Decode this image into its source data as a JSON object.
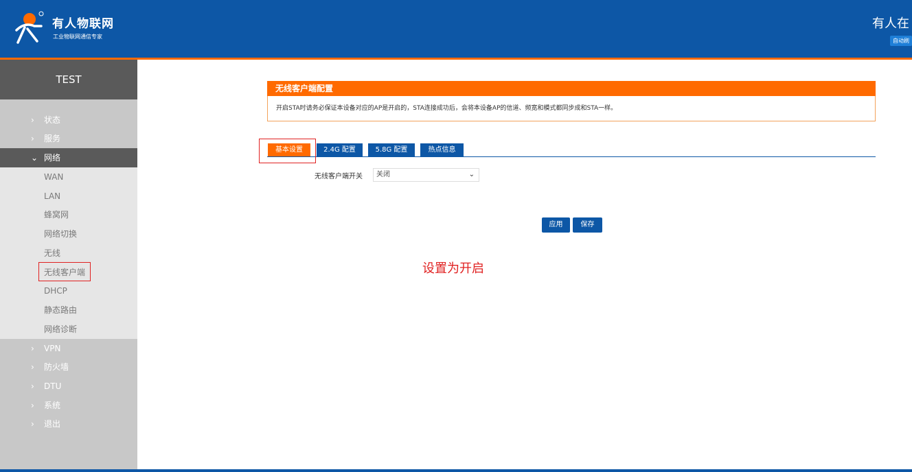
{
  "header": {
    "brand_name": "有人物联网",
    "brand_slogan": "工业物联网通信专家",
    "right_title": "有人在",
    "auto_badge": "自动刷"
  },
  "sidebar": {
    "device_name": "TEST",
    "menu": [
      {
        "label": "状态"
      },
      {
        "label": "服务"
      },
      {
        "label": "网络"
      },
      {
        "label": "VPN"
      },
      {
        "label": "防火墙"
      },
      {
        "label": "DTU"
      },
      {
        "label": "系统"
      },
      {
        "label": "退出"
      }
    ],
    "network_submenu": [
      "WAN",
      "LAN",
      "蜂窝网",
      "网络切换",
      "无线",
      "无线客户端",
      "DHCP",
      "静态路由",
      "网络诊断"
    ]
  },
  "panel": {
    "title": "无线客户端配置",
    "notice": "开启STA时请务必保证本设备对应的AP是开启的，STA连接成功后，会将本设备AP的信道、频宽和模式都同步成和STA一样。"
  },
  "tabs": [
    "基本设置",
    "2.4G 配置",
    "5.8G 配置",
    "热点信息"
  ],
  "form": {
    "switch_label": "无线客户端开关",
    "switch_value": "关闭"
  },
  "buttons": {
    "apply": "应用",
    "save": "保存"
  },
  "annotation": "设置为开启",
  "colors": {
    "header_blue": "#0d57a6",
    "accent_orange": "#ff6a00",
    "highlight_red": "#e02020"
  }
}
